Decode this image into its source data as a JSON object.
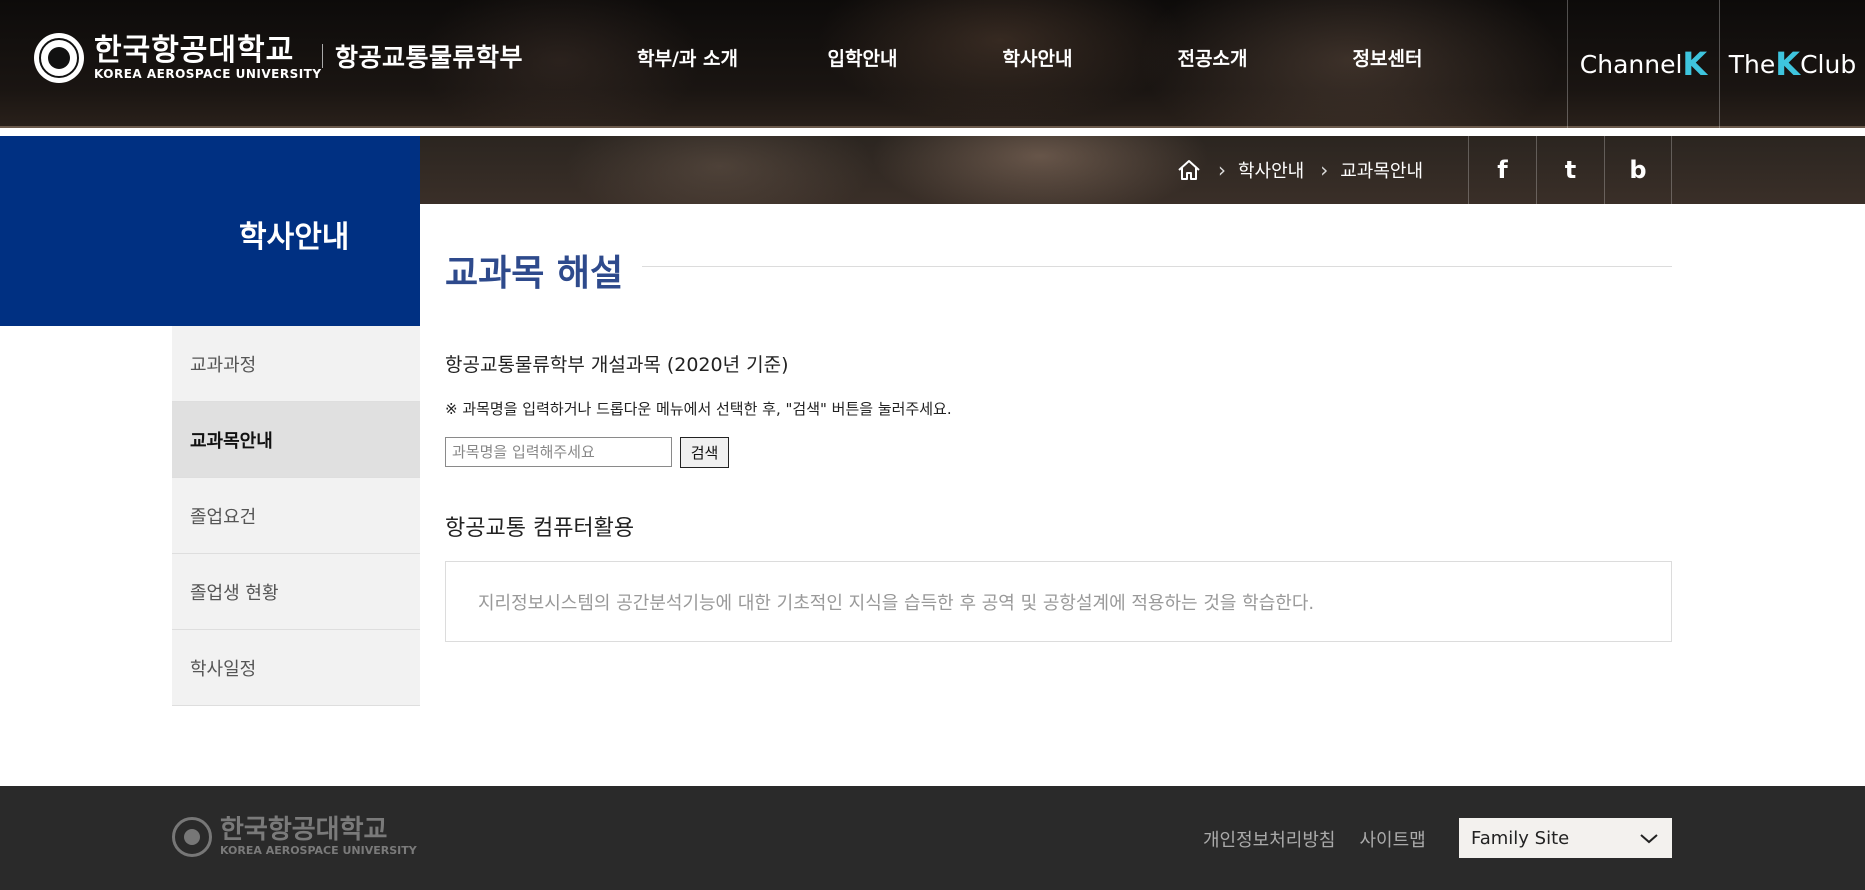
{
  "header": {
    "logo_kr": "한국항공대학교",
    "logo_en": "KOREA AEROSPACE UNIVERSITY",
    "dept_name": "항공교통물류학부",
    "nav": [
      {
        "label": "학부/과 소개"
      },
      {
        "label": "입학안내"
      },
      {
        "label": "학사안내"
      },
      {
        "label": "전공소개"
      },
      {
        "label": "정보센터"
      }
    ],
    "channel_k": {
      "prefix": "Channel",
      "accent": "K"
    },
    "the_k_club": {
      "prefix": "The",
      "accent": "K",
      "suffix": "Club"
    }
  },
  "breadcrumb": {
    "items": [
      "학사안내",
      "교과목안내"
    ]
  },
  "sns": [
    "f",
    "t",
    "b"
  ],
  "sidebar": {
    "title": "학사안내",
    "items": [
      {
        "label": "교과과정",
        "active": false
      },
      {
        "label": "교과목안내",
        "active": true
      },
      {
        "label": "졸업요건",
        "active": false
      },
      {
        "label": "졸업생 현황",
        "active": false
      },
      {
        "label": "학사일정",
        "active": false
      }
    ]
  },
  "content": {
    "title": "교과목 해설",
    "caption": "항공교통물류학부 개설과목 (2020년 기준)",
    "notice": "※ 과목명을 입력하거나 드롭다운 메뉴에서 선택한 후, \"검색\" 버튼을 눌러주세요.",
    "search": {
      "placeholder": "과목명을 입력해주세요",
      "button": "검색"
    },
    "course": {
      "name": "항공교통 컴퓨터활용",
      "description": "지리정보시스템의 공간분석기능에 대한 기초적인 지식을 습득한 후 공역 및 공항설계에 적용하는 것을 학습한다."
    }
  },
  "footer": {
    "logo_kr": "한국항공대학교",
    "logo_en": "KOREA AEROSPACE UNIVERSITY",
    "links": [
      "개인정보처리방침",
      "사이트맵"
    ],
    "family_site": "Family Site"
  },
  "colors": {
    "primary_blue": "#003082",
    "title_blue": "#2e4a8c",
    "accent_cyan": "#3ec5de",
    "footer_bg": "#2a2a2a"
  }
}
